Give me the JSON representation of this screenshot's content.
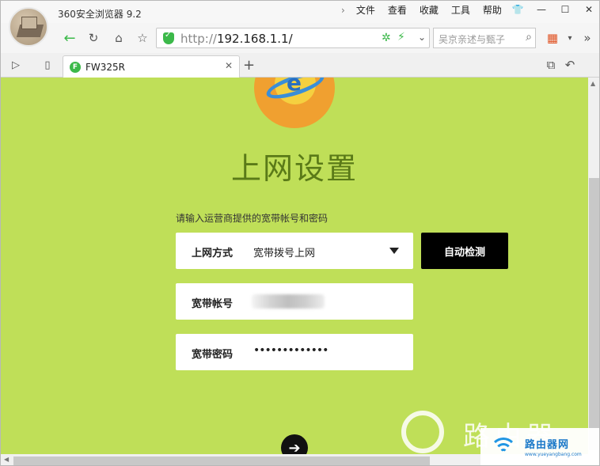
{
  "browser": {
    "app_title": "360安全浏览器 9.2",
    "menu": [
      "文件",
      "查看",
      "收藏",
      "工具",
      "帮助"
    ],
    "address_protocol": "http://",
    "address_host": "192.168.1.1/",
    "search_placeholder": "吴京亲述与甄子",
    "tab_title": "FW325R",
    "tab_favicon_letter": "F"
  },
  "page": {
    "heading": "上网设置",
    "hint": "请输入运营商提供的宽带帐号和密码",
    "connection_type_label": "上网方式",
    "connection_type_value": "宽带拨号上网",
    "auto_detect_button": "自动检测",
    "account_label": "宽带帐号",
    "password_label": "宽带密码",
    "password_value": "•••••••••••••"
  },
  "watermark": {
    "big_text": "路由器",
    "badge_title": "路由器网",
    "badge_sub": "www.yueyangbang.com"
  },
  "colors": {
    "content_bg": "#bfdf58",
    "heading": "#5a7a18",
    "accent_green": "#3cb94a",
    "button_black": "#000000"
  }
}
